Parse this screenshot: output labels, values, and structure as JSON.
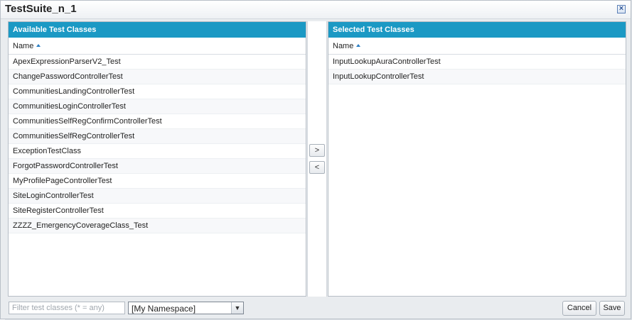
{
  "dialog": {
    "title": "TestSuite_n_1",
    "close_glyph": "×"
  },
  "available": {
    "header": "Available Test Classes",
    "column": "Name",
    "items": [
      "ApexExpressionParserV2_Test",
      "ChangePasswordControllerTest",
      "CommunitiesLandingControllerTest",
      "CommunitiesLoginControllerTest",
      "CommunitiesSelfRegConfirmControllerTest",
      "CommunitiesSelfRegControllerTest",
      "ExceptionTestClass",
      "ForgotPasswordControllerTest",
      "MyProfilePageControllerTest",
      "SiteLoginControllerTest",
      "SiteRegisterControllerTest",
      "ZZZZ_EmergencyCoverageClass_Test"
    ]
  },
  "selected": {
    "header": "Selected Test Classes",
    "column": "Name",
    "items": [
      "InputLookupAuraControllerTest",
      "InputLookupControllerTest"
    ]
  },
  "transfer": {
    "add_label": ">",
    "remove_label": "<"
  },
  "footer": {
    "filter_placeholder": "Filter test classes (* = any)",
    "filter_value": "",
    "namespace_value": "[My Namespace]",
    "cancel_label": "Cancel",
    "save_label": "Save"
  },
  "colors": {
    "header_blue": "#1b99c4",
    "sort_arrow": "#2a7ec4"
  }
}
